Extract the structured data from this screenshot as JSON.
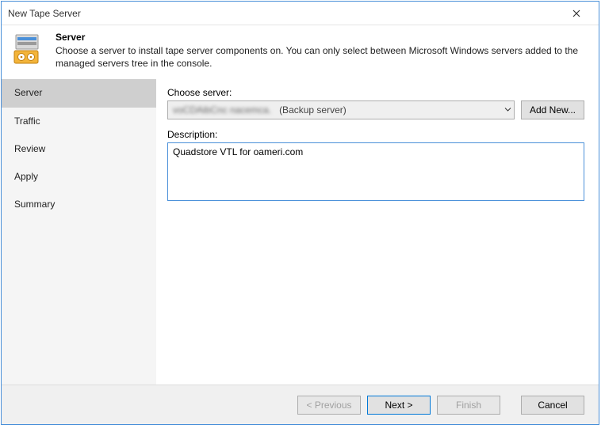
{
  "window": {
    "title": "New Tape Server"
  },
  "header": {
    "title": "Server",
    "description": "Choose a server to install tape server components on. You can only select between Microsoft Windows servers added to the managed servers tree in the console."
  },
  "sidebar": {
    "items": [
      {
        "label": "Server",
        "active": true
      },
      {
        "label": "Traffic",
        "active": false
      },
      {
        "label": "Review",
        "active": false
      },
      {
        "label": "Apply",
        "active": false
      },
      {
        "label": "Summary",
        "active": false
      }
    ]
  },
  "form": {
    "choose_server_label": "Choose server:",
    "server_value_obscured": "voCDAibCnc  nacemca.",
    "server_value_suffix": "(Backup server)",
    "add_new_label": "Add New...",
    "description_label": "Description:",
    "description_value": "Quadstore VTL for oameri.com"
  },
  "footer": {
    "previous": "< Previous",
    "next": "Next >",
    "finish": "Finish",
    "cancel": "Cancel"
  }
}
